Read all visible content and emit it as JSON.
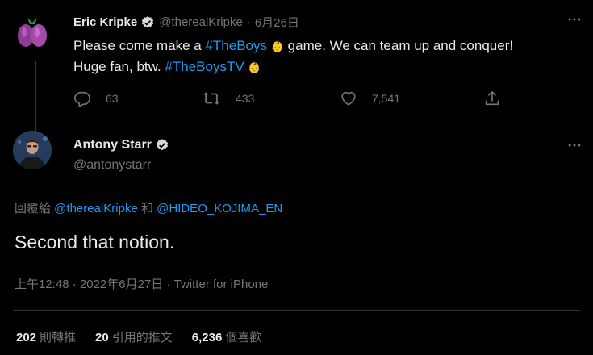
{
  "colors": {
    "background": "#000000",
    "text": "#e7e9ea",
    "muted": "#71767b",
    "link": "#1d9bf0",
    "verified": "#d9d9d9"
  },
  "parent_tweet": {
    "author_name": "Eric Kripke",
    "handle": "@therealKripke",
    "separator": "·",
    "date": "6月26日",
    "text_segments": [
      {
        "text": "Please come make a ",
        "type": "text"
      },
      {
        "text": "#TheBoys",
        "type": "hashtag"
      },
      {
        "text": "👶",
        "type": "emoji"
      },
      {
        "text": " game. We can team up and conquer!",
        "type": "text"
      }
    ],
    "text_line2": [
      {
        "text": "Huge fan, btw. ",
        "type": "text"
      },
      {
        "text": "#TheBoysTV",
        "type": "hashtag"
      },
      {
        "text": "👶",
        "type": "emoji"
      }
    ],
    "reply_count": "63",
    "retweet_count": "433",
    "like_count": "7,541",
    "icons": {
      "reply": "reply-icon",
      "retweet": "retweet-icon",
      "like": "heart-icon",
      "share": "share-icon",
      "more": "more-icon"
    }
  },
  "main_tweet": {
    "author_name": "Antony Starr",
    "handle": "@antonystarr",
    "reply_prefix": "回覆給 ",
    "reply_to_1": "@therealKripke",
    "reply_and": " 和 ",
    "reply_to_2": "@HIDEO_KOJIMA_EN",
    "text": "Second that notion.",
    "time": "上午12:48",
    "separator": "·",
    "date": "2022年6月27日",
    "source_sep": "·",
    "source": "Twitter for iPhone",
    "stats": {
      "retweets": "202",
      "retweets_label": "則轉推",
      "quotes": "20",
      "quotes_label": "引用的推文",
      "likes": "6,236",
      "likes_label": "個喜歡"
    }
  }
}
